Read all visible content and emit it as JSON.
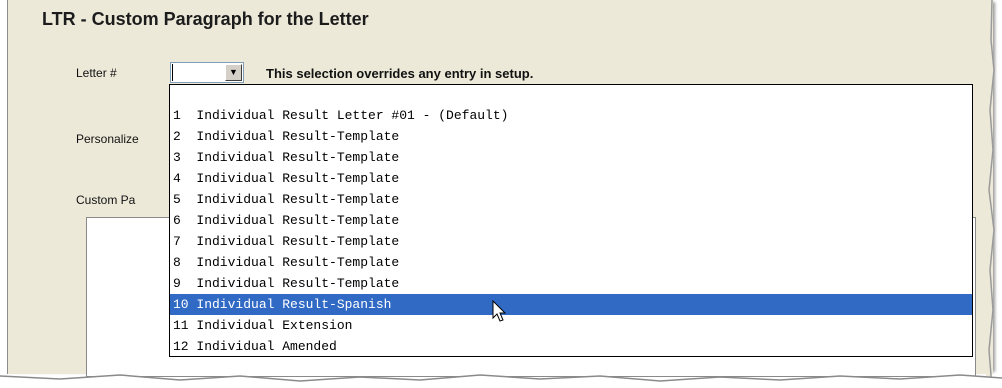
{
  "window": {
    "title": "LTR - Custom Paragraph for the Letter"
  },
  "form": {
    "letter_label": "Letter #",
    "letter_value": "",
    "override_note": "This selection overrides any entry in setup.",
    "personalize_label": "Personalize",
    "custom_paragraph_label": "Custom Pa",
    "dropdown_arrow": "▼"
  },
  "dropdown": {
    "items": [
      {
        "label": "1  Individual Result Letter #01 - (Default)",
        "selected": false
      },
      {
        "label": "2  Individual Result-Template",
        "selected": false
      },
      {
        "label": "3  Individual Result-Template",
        "selected": false
      },
      {
        "label": "4  Individual Result-Template",
        "selected": false
      },
      {
        "label": "5  Individual Result-Template",
        "selected": false
      },
      {
        "label": "6  Individual Result-Template",
        "selected": false
      },
      {
        "label": "7  Individual Result-Template",
        "selected": false
      },
      {
        "label": "8  Individual Result-Template",
        "selected": false
      },
      {
        "label": "9  Individual Result-Template",
        "selected": false
      },
      {
        "label": "10 Individual Result-Spanish",
        "selected": true
      },
      {
        "label": "11 Individual Extension",
        "selected": false
      },
      {
        "label": "12 Individual Amended",
        "selected": false
      }
    ]
  },
  "colors": {
    "selection": "#316ac5",
    "window_bg": "#ece9d8"
  }
}
